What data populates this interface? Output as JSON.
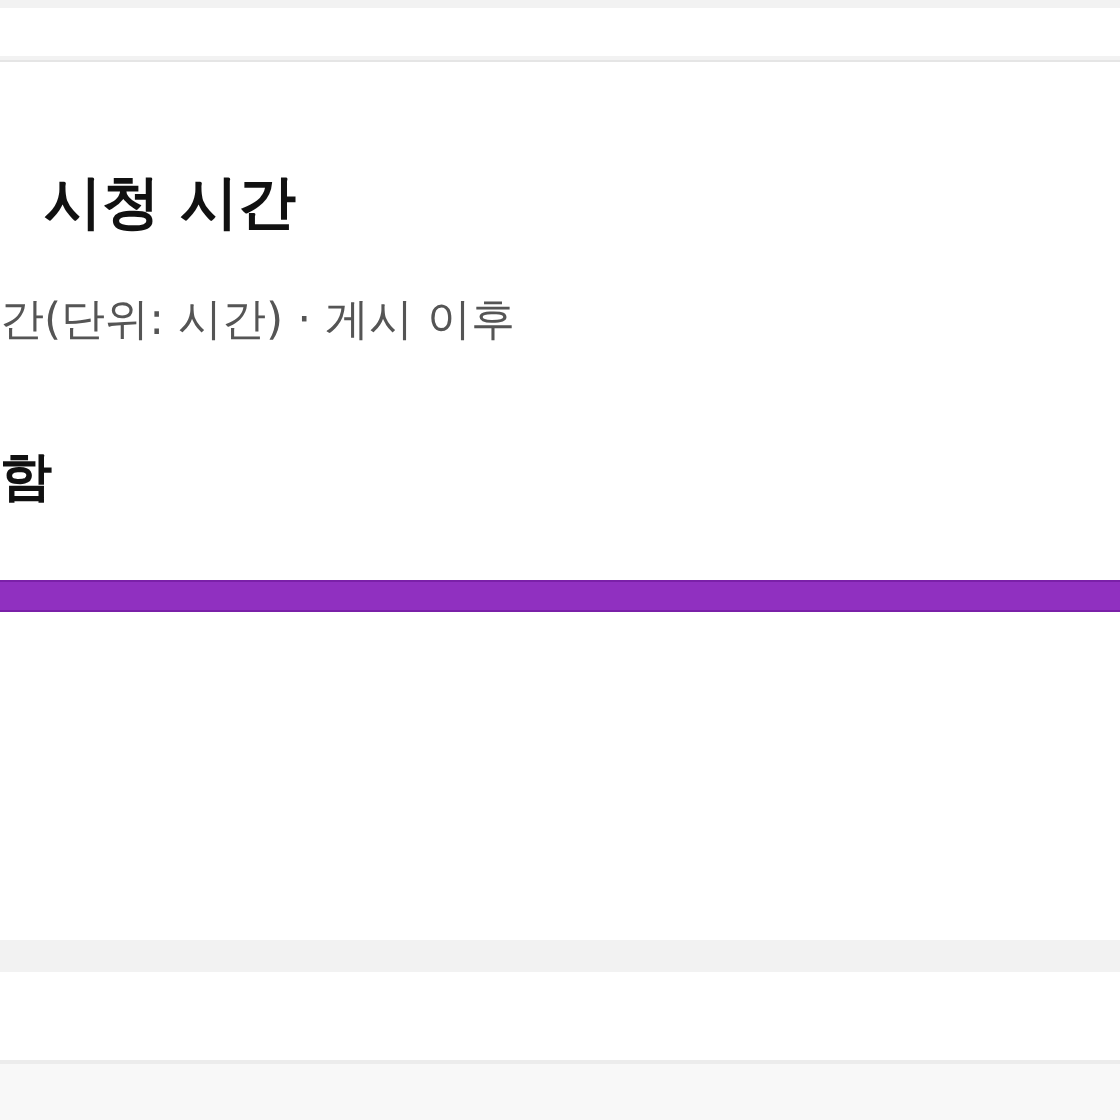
{
  "card": {
    "title": "시청 시간",
    "subtitle": "간(단위: 시간) · 게시 이후",
    "label": "함"
  }
}
